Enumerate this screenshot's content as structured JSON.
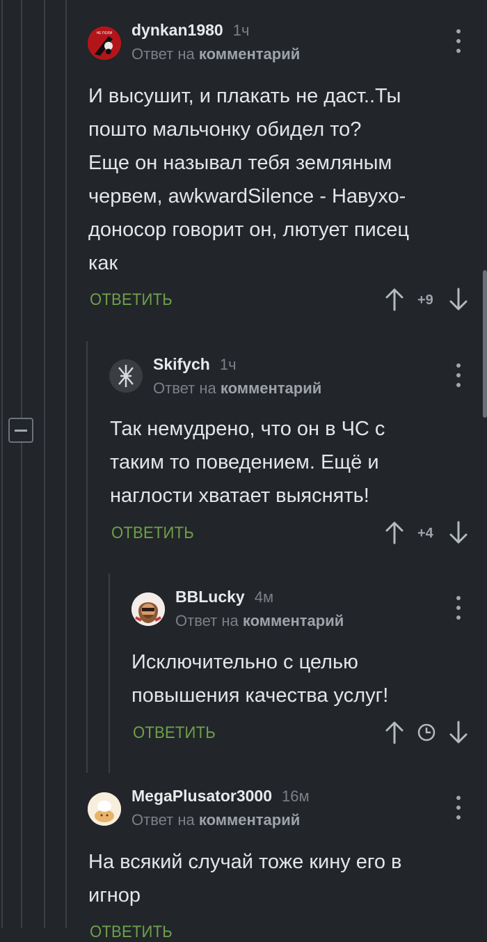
{
  "comments": [
    {
      "author": "dynkan1980",
      "time": "1ч",
      "reply_prefix": "Ответ на",
      "reply_link": "комментарий",
      "text_lines": [
        "И высушит, и плакать не даст..Ты",
        "пошто мальчонку обидел то?",
        "Еще он называл тебя земляным",
        "червем, awkwardSilence - Навухо-",
        "доносор говорит он, лютует писец",
        "как"
      ],
      "reply_label": "ОТВЕТИТЬ",
      "rating": "+9"
    },
    {
      "author": "Skifych",
      "time": "1ч",
      "reply_prefix": "Ответ на",
      "reply_link": "комментарий",
      "text_lines": [
        "Так немудрено, что он в ЧС с",
        "таким то поведением. Ещё и",
        "наглости хватает выяснять!"
      ],
      "reply_label": "ОТВЕТИТЬ",
      "rating": "+4"
    },
    {
      "author": "BBLucky",
      "time": "4м",
      "reply_prefix": "Ответ на",
      "reply_link": "комментарий",
      "text_lines": [
        "Исключительно с целью",
        "повышения качества услуг!"
      ],
      "reply_label": "ОТВЕТИТЬ"
    },
    {
      "author": "MegaPlusator3000",
      "time": "16м",
      "reply_prefix": "Ответ на",
      "reply_link": "комментарий",
      "text_lines": [
        "На всякий случай тоже кину его в",
        "игнор"
      ],
      "reply_label": "ОТВЕТИТЬ"
    }
  ],
  "avatar_text": {
    "dynkan1980": "НЕ ПОЛИ"
  },
  "colors": {
    "background": "#222529",
    "reply_green": "#6ea04b",
    "muted": "#7c8187",
    "thread_line": "#3c4045"
  },
  "icons": [
    "upvote-arrow-icon",
    "downvote-arrow-icon",
    "clock-icon",
    "more-dots-icon",
    "collapse-minus-icon"
  ]
}
